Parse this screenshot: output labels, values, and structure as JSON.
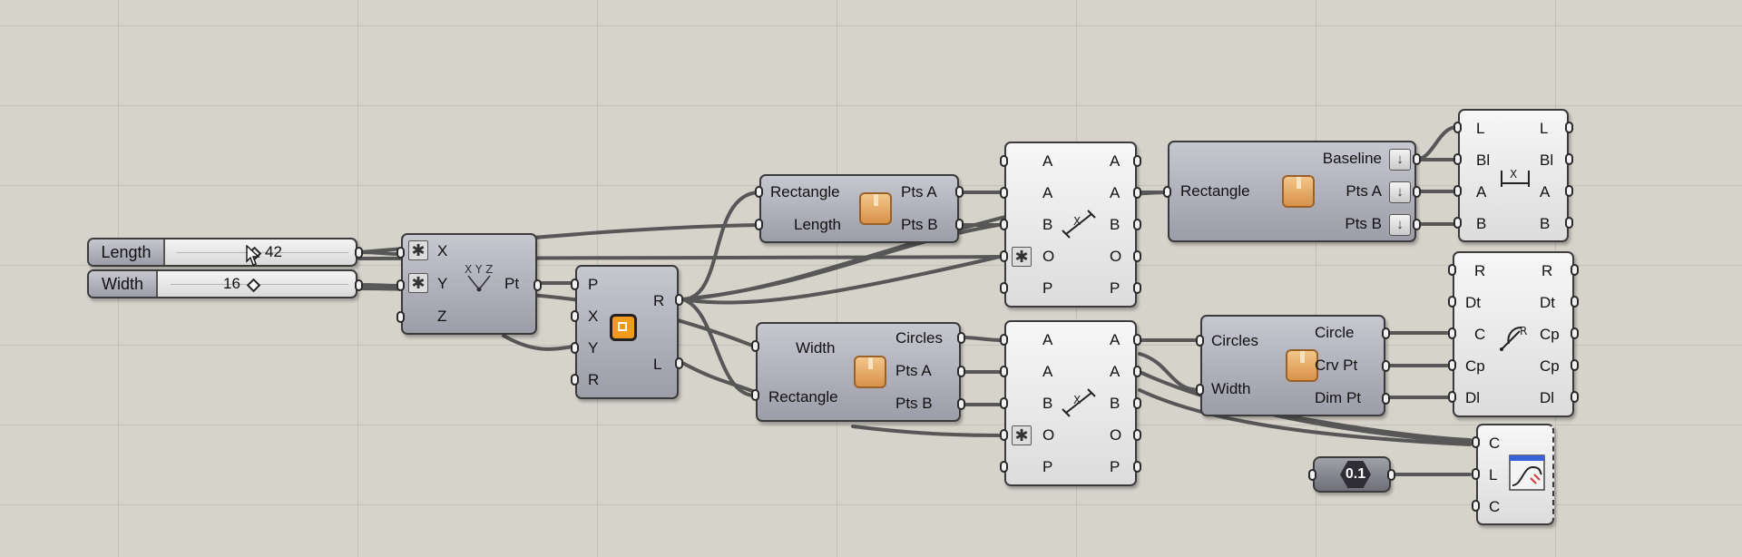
{
  "sliders": {
    "length": {
      "label": "Length",
      "value": "42"
    },
    "width": {
      "label": "Width",
      "value": "16"
    }
  },
  "construct_point": {
    "inputs": [
      "X",
      "Y",
      "Z"
    ],
    "output": "Pt",
    "icon": "xyz-point-icon"
  },
  "rectangle": {
    "inputs": [
      "P",
      "X",
      "Y",
      "R"
    ],
    "outputs": [
      "R",
      "L"
    ],
    "icon": "rectangle-icon"
  },
  "cluster_top": {
    "inputs": [
      "Rectangle",
      "Length"
    ],
    "outputs": [
      "Pts A",
      "Pts B"
    ],
    "icon": "package-icon"
  },
  "cluster_mid": {
    "inputs": [
      "Width",
      "Rectangle"
    ],
    "outputs": [
      "Circles",
      "Pts A",
      "Pts B"
    ],
    "icon": "package-icon"
  },
  "dimension_top": {
    "inputs": [
      "A",
      "A",
      "B",
      "O",
      "P"
    ],
    "outputs": [
      "A",
      "A",
      "B",
      "O",
      "P"
    ],
    "icon": "linear-dimension-icon"
  },
  "dimension_mid": {
    "inputs": [
      "A",
      "A",
      "B",
      "O",
      "P"
    ],
    "outputs": [
      "A",
      "A",
      "B",
      "O",
      "P"
    ],
    "icon": "linear-dimension-icon"
  },
  "cluster_baseline": {
    "inputs": [
      "Rectangle"
    ],
    "outputs": [
      "Baseline",
      "Pts A",
      "Pts B"
    ],
    "icon": "package-icon"
  },
  "dim_out_top": {
    "inputs": [
      "L",
      "Bl",
      "A",
      "B"
    ],
    "outputs": [
      "L",
      "Bl",
      "A",
      "B"
    ],
    "icon": "dimension-x-icon"
  },
  "cluster_circles": {
    "inputs": [
      "Circles",
      "Width"
    ],
    "outputs": [
      "Circle",
      "Crv Pt",
      "Dim Pt"
    ],
    "icon": "package-icon"
  },
  "radial_dim": {
    "inputs": [
      "R",
      "Dt",
      "C",
      "Cp",
      "Dl"
    ],
    "outputs": [
      "R",
      "Dt",
      "Cp",
      "Cp",
      "Dl"
    ],
    "icon": "radius-dimension-icon"
  },
  "number_param": {
    "value": "0.1"
  },
  "preview": {
    "inputs": [
      "C",
      "L",
      "C"
    ],
    "icon": "curve-preview-icon"
  },
  "colors": {
    "canvas": "#d6d3cb",
    "wire": "#5a5a5a",
    "component": "#a5a6b0"
  }
}
